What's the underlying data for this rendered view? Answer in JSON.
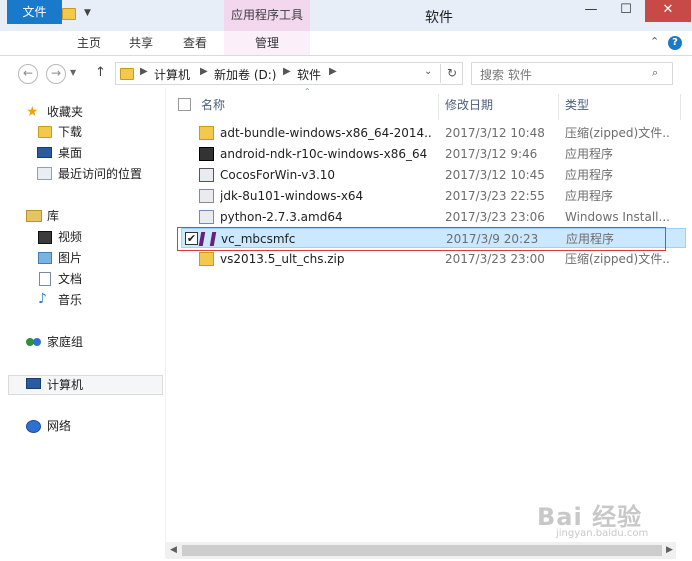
{
  "window": {
    "title": "软件",
    "context_tab": "应用程序工具",
    "close_glyph": "✕",
    "minimize_glyph": "—",
    "maximize_glyph": "☐"
  },
  "ribbon": {
    "tabs": [
      "文件",
      "主页",
      "共享",
      "查看",
      "管理"
    ],
    "help": "?",
    "collapse": "⌃"
  },
  "address": {
    "back": "←",
    "forward": "→",
    "up": "↑",
    "crumbs": [
      "计算机",
      "新加卷 (D:)",
      "软件"
    ],
    "refresh": "↻",
    "dropdown": "⌄"
  },
  "search": {
    "placeholder": "搜索 软件",
    "icon": "🔍"
  },
  "nav": {
    "favorites": {
      "label": "收藏夹",
      "items": [
        "下载",
        "桌面",
        "最近访问的位置"
      ]
    },
    "library": {
      "label": "库",
      "items": [
        "视频",
        "图片",
        "文档",
        "音乐"
      ]
    },
    "homegroup": "家庭组",
    "computer": "计算机",
    "network": "网络"
  },
  "columns": {
    "name": "名称",
    "date": "修改日期",
    "type": "类型",
    "sort_glyph": "⌃"
  },
  "files": [
    {
      "name": "adt-bundle-windows-x86_64-2014...",
      "date": "2017/3/12 10:48",
      "type": "压缩(zipped)文件...",
      "icon": "zip-folder-icon",
      "color": "#f2c94c"
    },
    {
      "name": "android-ndk-r10c-windows-x86_64",
      "date": "2017/3/12 9:46",
      "type": "应用程序",
      "icon": "7z-icon",
      "color": "#333333"
    },
    {
      "name": "CocosForWin-v3.10",
      "date": "2017/3/12 10:45",
      "type": "应用程序",
      "icon": "cocos-icon",
      "color": "#555555"
    },
    {
      "name": "jdk-8u101-windows-x64",
      "date": "2017/3/23 22:55",
      "type": "应用程序",
      "icon": "java-icon",
      "color": "#8a8a8a"
    },
    {
      "name": "python-2.7.3.amd64",
      "date": "2017/3/23 23:06",
      "type": "Windows Install...",
      "icon": "installer-icon",
      "color": "#6a8fb8"
    },
    {
      "name": "vc_mbcsmfc",
      "date": "2017/3/9 20:23",
      "type": "应用程序",
      "icon": "visual-studio-icon",
      "color": "#68217a",
      "selected": true
    },
    {
      "name": "vs2013.5_ult_chs.zip",
      "date": "2017/3/23 23:00",
      "type": "压缩(zipped)文件...",
      "icon": "zip-folder-icon",
      "color": "#f2c94c"
    }
  ],
  "checkmark": "✔",
  "scroll": {
    "left": "◀",
    "right": "▶"
  },
  "watermark": {
    "main": "Bai 经验",
    "sub": "jingyan.baidu.com"
  }
}
